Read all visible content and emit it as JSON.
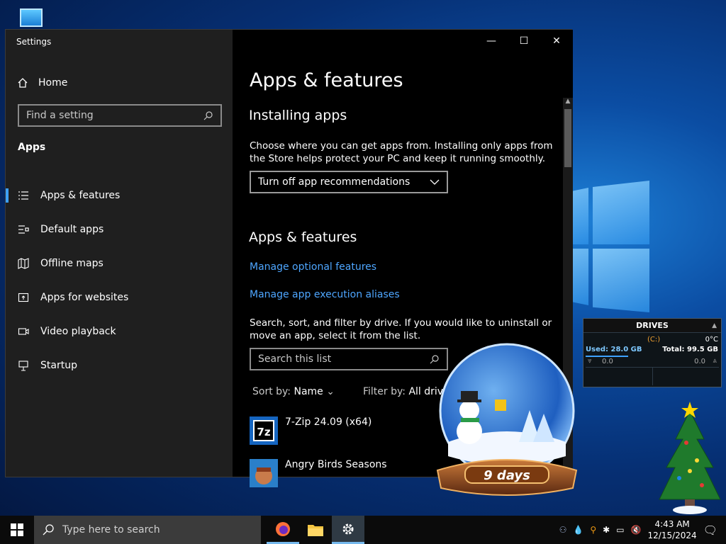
{
  "window": {
    "title": "Settings",
    "caption": {
      "minimize": "—",
      "maximize": "☐",
      "close": "✕"
    }
  },
  "sidebar": {
    "home_label": "Home",
    "search_placeholder": "Find a setting",
    "section": "Apps",
    "items": [
      {
        "label": "Apps & features",
        "icon": "list-icon",
        "active": true
      },
      {
        "label": "Default apps",
        "icon": "default-apps-icon"
      },
      {
        "label": "Offline maps",
        "icon": "map-icon"
      },
      {
        "label": "Apps for websites",
        "icon": "web-apps-icon"
      },
      {
        "label": "Video playback",
        "icon": "video-icon"
      },
      {
        "label": "Startup",
        "icon": "startup-icon"
      }
    ]
  },
  "main": {
    "page_title": "Apps & features",
    "installing": {
      "heading": "Installing apps",
      "description": "Choose where you can get apps from. Installing only apps from the Store helps protect your PC and keep it running smoothly.",
      "dropdown_value": "Turn off app recommendations"
    },
    "features": {
      "heading": "Apps & features",
      "link1": "Manage optional features",
      "link2": "Manage app execution aliases",
      "description": "Search, sort, and filter by drive. If you would like to uninstall or move an app, select it from the list.",
      "search_placeholder": "Search this list",
      "sort_label": "Sort by:",
      "sort_value": "Name",
      "filter_label": "Filter by:",
      "filter_value": "All drives"
    },
    "apps": [
      {
        "name": "7-Zip 24.09 (x64)",
        "icon": "7zip-icon"
      },
      {
        "name": "Angry Birds Seasons",
        "icon": "angry-birds-icon"
      }
    ]
  },
  "gadgets": {
    "drives": {
      "title": "DRIVES",
      "drive": "(C:)",
      "temp": "0°C",
      "used": "Used: 28.0 GB",
      "total": "Total: 99.5 GB",
      "down": "0.0",
      "up": "0.0"
    },
    "snowglobe": {
      "caption": "9 days"
    }
  },
  "taskbar": {
    "search_placeholder": "Type here to search",
    "apps": [
      "firefox-icon",
      "file-explorer-icon",
      "settings-icon"
    ],
    "time": "4:43 AM",
    "date": "12/15/2024"
  },
  "colors": {
    "accent": "#3ea1ff",
    "link": "#4ea6ff",
    "sidebar": "#1f1f1f",
    "content": "#000000"
  }
}
